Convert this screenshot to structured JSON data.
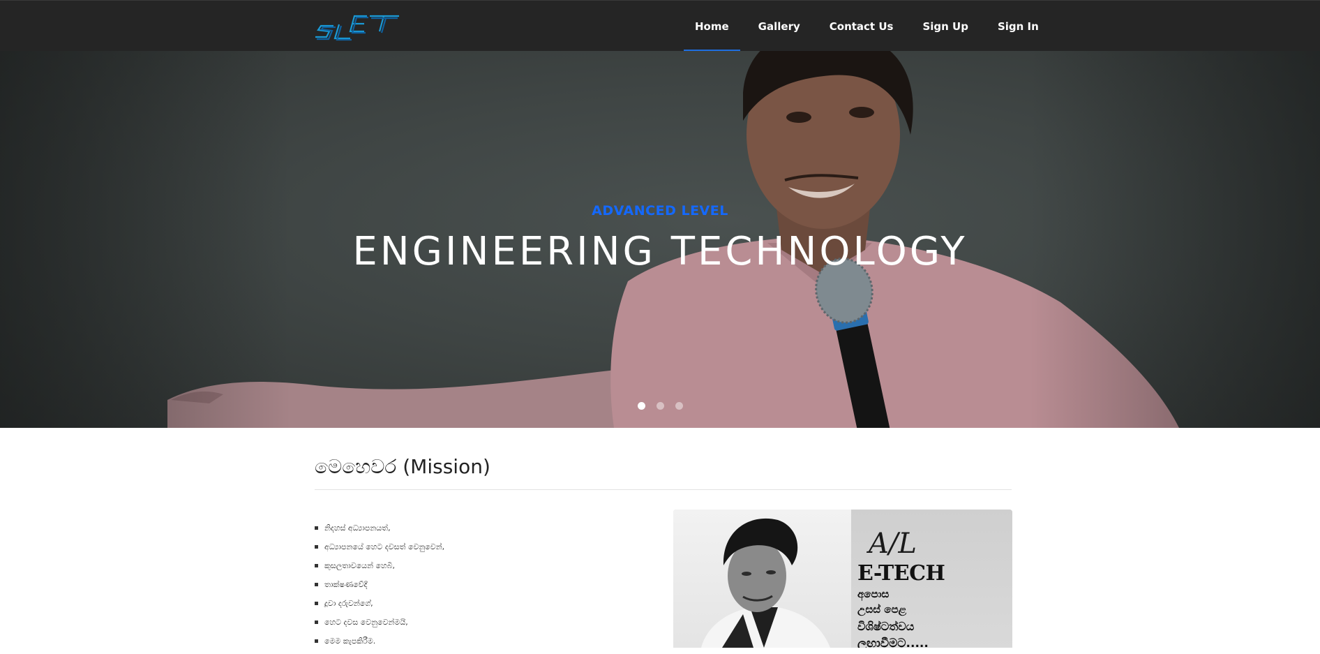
{
  "nav": {
    "logo_text": "SLET",
    "items": [
      {
        "label": "Home",
        "active": true
      },
      {
        "label": "Gallery",
        "active": false
      },
      {
        "label": "Contact Us",
        "active": false
      },
      {
        "label": "Sign Up",
        "active": false
      },
      {
        "label": "Sign In",
        "active": false
      }
    ]
  },
  "hero": {
    "eyebrow": "ADVANCED LEVEL",
    "title": "ENGINEERING TECHNOLOGY",
    "slide_count": 3,
    "active_slide": 1
  },
  "mission": {
    "title": "මෙහෙවර (Mission)",
    "items": [
      "නිදහස් අධ්‍යාපනයත්,",
      "අධ්‍යාපනයේ හෙට දවසත් වෙනුවෙන්,",
      "කුසලතාවයෙන් හෙබි,",
      "තාක්ෂණවේදී",
      "දූවා දරුවන්ගේ,",
      "හෙට දවස වෙනුවෙන්මයි,",
      "මෙම කැපකිරීම."
    ]
  },
  "poster": {
    "line_al": "A/L",
    "line_etech": "E-TECH",
    "line_1": "අපොස",
    "line_2": "උසස් පෙළ",
    "line_3": "විශිෂ්ටත්වය",
    "line_4": "ලඟාවීමට....."
  },
  "colors": {
    "nav_bg": "#252525",
    "accent": "#1e6fe0",
    "eyebrow": "#1469ff",
    "shirt": "#c9979e"
  }
}
